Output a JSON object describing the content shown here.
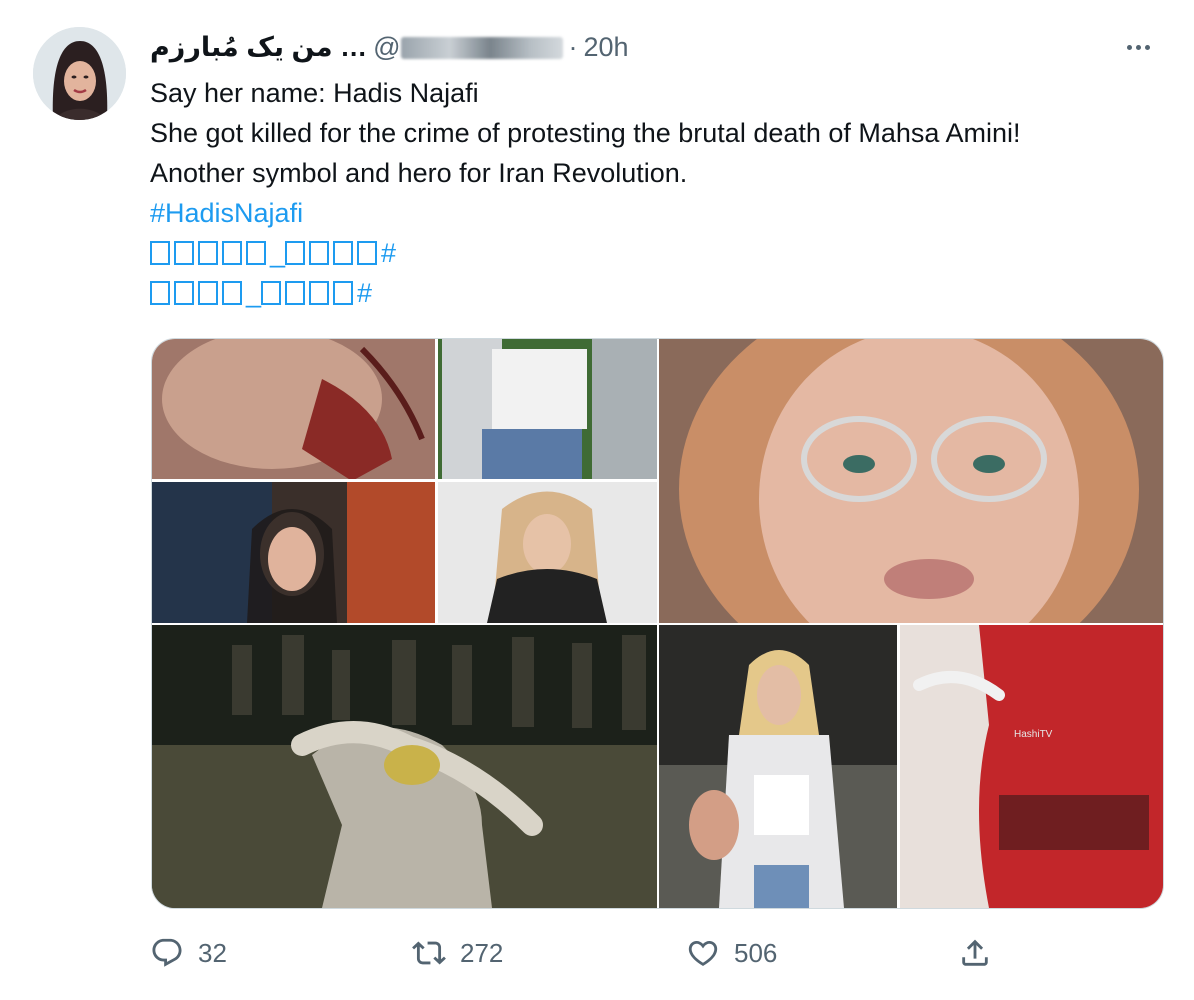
{
  "tweet": {
    "display_name": "من یک مُبارزم …",
    "handle": "@",
    "separator": "·",
    "time": "20h",
    "lines": [
      "Say her name: Hadis Najafi",
      "She got killed for the crime of protesting the brutal death of Mahsa Amini!",
      "Another symbol and hero for Iran Revolution."
    ],
    "hashtag": "#HadisNajafi",
    "hashtag_rtl_1": "#",
    "hashtag_rtl_2": "#"
  },
  "actions": {
    "reply_count": "32",
    "retweet_count": "272",
    "like_count": "506"
  },
  "icons": {
    "more": "more-horizontal-icon",
    "reply": "reply-icon",
    "retweet": "retweet-icon",
    "like": "heart-icon",
    "share": "share-icon"
  },
  "colors": {
    "link": "#1d9bf0",
    "secondary": "#536471",
    "text": "#0f1419"
  },
  "media": {
    "watermark": "HashiTV"
  }
}
